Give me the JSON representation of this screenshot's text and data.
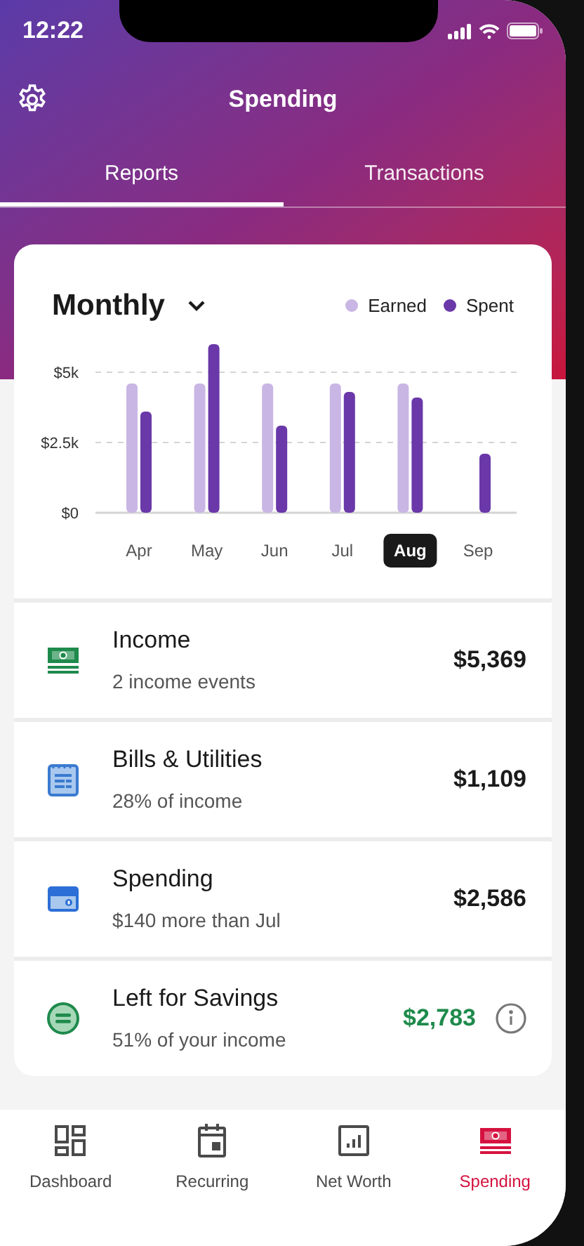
{
  "status_bar": {
    "time": "12:22"
  },
  "header": {
    "title": "Spending"
  },
  "tabs": [
    {
      "label": "Reports",
      "selected": true
    },
    {
      "label": "Transactions",
      "selected": false
    }
  ],
  "report_card": {
    "period": "Monthly",
    "months": [
      {
        "label": "Apr",
        "selected": false
      },
      {
        "label": "May",
        "selected": false
      },
      {
        "label": "Jun",
        "selected": false
      },
      {
        "label": "Jul",
        "selected": false
      },
      {
        "label": "Aug",
        "selected": true
      },
      {
        "label": "Sep",
        "selected": false
      }
    ],
    "chart_data": {
      "type": "bar",
      "ylim": [
        0,
        6
      ],
      "yticks": [
        {
          "value": 0,
          "label": "$0"
        },
        {
          "value": 2.5,
          "label": "$2.5k"
        },
        {
          "value": 5,
          "label": "$5k"
        }
      ],
      "series": [
        {
          "name": "Earned",
          "color": "#c9b6e4",
          "values": [
            4.6,
            4.6,
            4.6,
            4.6,
            4.6,
            null
          ]
        },
        {
          "name": "Spent",
          "color": "#6a38a8",
          "values": [
            3.6,
            6.0,
            3.1,
            4.3,
            4.1,
            2.1
          ]
        }
      ]
    }
  },
  "summary_rows": [
    {
      "kind": "income",
      "title": "Income",
      "subtitle": "2 income events",
      "amount": "$5,369",
      "info": false
    },
    {
      "kind": "bills",
      "title": "Bills & Utilities",
      "subtitle": "28% of income",
      "amount": "$1,109",
      "info": false
    },
    {
      "kind": "spending",
      "title": "Spending",
      "subtitle": "$140 more than Jul",
      "amount": "$2,586",
      "info": false
    },
    {
      "kind": "savings",
      "title": "Left for Savings",
      "subtitle": "51% of your income",
      "amount": "$2,783",
      "info": true
    }
  ],
  "bottom_nav": [
    {
      "kind": "dashboard",
      "label": "Dashboard",
      "selected": false
    },
    {
      "kind": "recurring",
      "label": "Recurring",
      "selected": false
    },
    {
      "kind": "networth",
      "label": "Net Worth",
      "selected": false
    },
    {
      "kind": "spending",
      "label": "Spending",
      "selected": true
    }
  ]
}
